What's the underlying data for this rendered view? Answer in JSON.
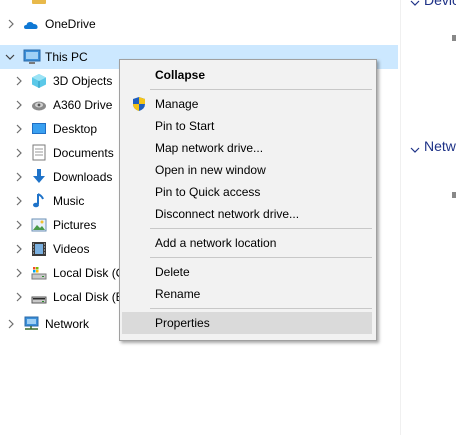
{
  "nav": {
    "onedrive": "OneDrive",
    "this_pc": "This PC",
    "items": [
      {
        "label": "3D Objects",
        "icon": "3d-objects-icon"
      },
      {
        "label": "A360 Drive",
        "icon": "a360-drive-icon"
      },
      {
        "label": "Desktop",
        "icon": "desktop-icon"
      },
      {
        "label": "Documents",
        "icon": "documents-icon"
      },
      {
        "label": "Downloads",
        "icon": "downloads-icon"
      },
      {
        "label": "Music",
        "icon": "music-icon"
      },
      {
        "label": "Pictures",
        "icon": "pictures-icon"
      },
      {
        "label": "Videos",
        "icon": "videos-icon"
      },
      {
        "label": "Local Disk (C",
        "icon": "local-disk-c-icon"
      },
      {
        "label": "Local Disk (E",
        "icon": "local-disk-e-icon"
      }
    ],
    "network": "Network"
  },
  "right": {
    "devices_partial": "Devic",
    "network_group": "Netw"
  },
  "menu": {
    "collapse": "Collapse",
    "manage": "Manage",
    "pin_to_start": "Pin to Start",
    "map_network_drive": "Map network drive...",
    "open_new_window": "Open in new window",
    "pin_quick_access": "Pin to Quick access",
    "disconnect_network_drive": "Disconnect network drive...",
    "add_network_location": "Add a network location",
    "delete": "Delete",
    "rename": "Rename",
    "properties": "Properties"
  },
  "colors": {
    "selection": "#cce8ff",
    "menu_bg": "#f2f2f2",
    "menu_hover": "#dadada",
    "group_header": "#1e3287"
  }
}
